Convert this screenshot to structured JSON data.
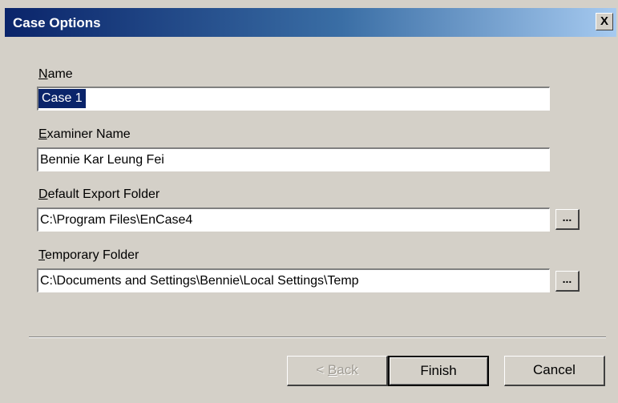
{
  "window": {
    "title": "Case Options",
    "close_label": "X"
  },
  "fields": {
    "name": {
      "label_access": "N",
      "label_rest": "ame",
      "value": "Case 1"
    },
    "examiner": {
      "label_access": "E",
      "label_rest": "xaminer Name",
      "value": "Bennie Kar Leung Fei"
    },
    "export": {
      "label_access": "D",
      "label_rest": "efault Export Folder",
      "value": "C:\\Program Files\\EnCase4",
      "browse_label": "..."
    },
    "temp": {
      "label_access": "T",
      "label_rest": "emporary Folder",
      "value": "C:\\Documents and Settings\\Bennie\\Local Settings\\Temp",
      "browse_label": "..."
    }
  },
  "buttons": {
    "back_prefix": "< ",
    "back_access": "B",
    "back_rest": "ack",
    "finish": "Finish",
    "cancel": "Cancel"
  }
}
